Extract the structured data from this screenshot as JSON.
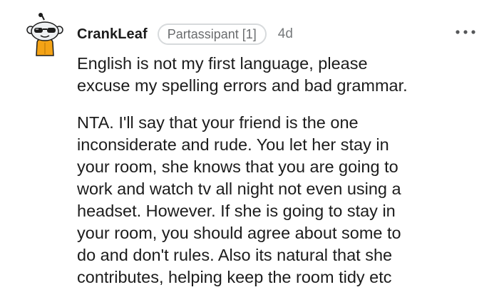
{
  "comment": {
    "author": "CrankLeaf",
    "flair": "Partassipant [1]",
    "timestamp": "4d",
    "avatar_icon": "snoo-avatar-sunglasses-icon",
    "more_icon": "more-options-icon",
    "paragraphs": [
      "English is not my first language, please\nexcuse my spelling errors and bad grammar.",
      "NTA. I'll say that your friend is the one\ninconsiderate and rude. You let her stay in\nyour room, she knows that you are going to\nwork and watch tv all night not even using a\nheadset. However. If she is going to stay in\nyour room, you should agree about some to\ndo and don't rules. Also its natural that she\ncontributes, helping keep the room tidy etc"
    ]
  },
  "colors": {
    "text": "#1c1c1c",
    "meta": "#777a7c",
    "flair_border": "#d7dadc",
    "avatar_body": "#f4a316",
    "avatar_head": "#eef0f2"
  }
}
